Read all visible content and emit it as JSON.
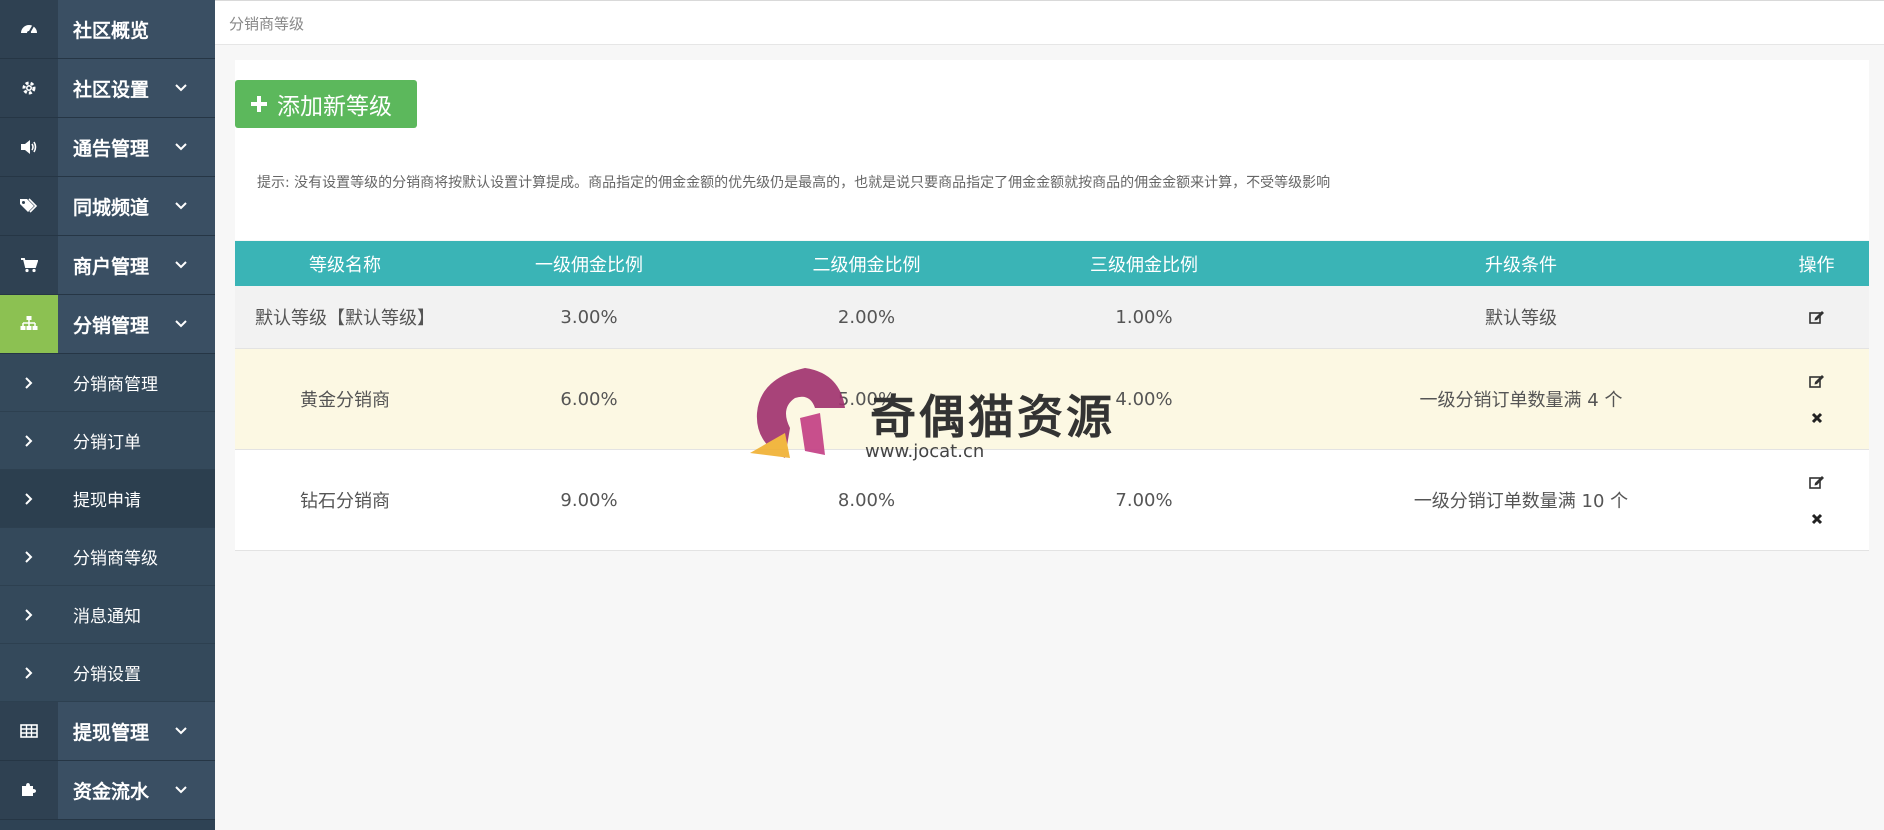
{
  "sidebar": {
    "items": [
      {
        "label": "社区概览",
        "icon": "dashboard-icon"
      },
      {
        "label": "社区设置",
        "icon": "gear-icon"
      },
      {
        "label": "通告管理",
        "icon": "volume-icon"
      },
      {
        "label": "同城频道",
        "icon": "tags-icon"
      },
      {
        "label": "商户管理",
        "icon": "cart-icon"
      },
      {
        "label": "分销管理",
        "icon": "sitemap-icon",
        "active": true
      },
      {
        "label": "提现管理",
        "icon": "table-icon"
      },
      {
        "label": "资金流水",
        "icon": "puzzle-icon"
      }
    ],
    "submenu": [
      {
        "label": "分销商管理"
      },
      {
        "label": "分销订单"
      },
      {
        "label": "提现申请"
      },
      {
        "label": "分销商等级"
      },
      {
        "label": "消息通知"
      },
      {
        "label": "分销设置"
      }
    ]
  },
  "breadcrumb": "分销商等级",
  "toolbar": {
    "add_label": "添加新等级"
  },
  "tip": "提示: 没有设置等级的分销商将按默认设置计算提成。商品指定的佣金金额的优先级仍是最高的，也就是说只要商品指定了佣金金额就按商品的佣金金额来计算，不受等级影响",
  "table": {
    "headers": [
      "等级名称",
      "一级佣金比例",
      "二级佣金比例",
      "三级佣金比例",
      "升级条件",
      "操作"
    ],
    "rows": [
      [
        "默认等级【默认等级】",
        "3.00%",
        "2.00%",
        "1.00%",
        "默认等级"
      ],
      [
        "黄金分销商",
        "6.00%",
        "5.00%",
        "4.00%",
        "一级分销订单数量满 4 个"
      ],
      [
        "钻石分销商",
        "9.00%",
        "8.00%",
        "7.00%",
        "一级分销订单数量满 10 个"
      ]
    ]
  },
  "watermark": {
    "text": "奇偶猫资源",
    "url": "www.jocat.cn"
  },
  "colors": {
    "accent": "#3ab4b6",
    "add_button": "#5cb85c",
    "active_menu": "#8cc152",
    "sidebar": "#2e4254",
    "highlight_row": "#fcf8e3"
  }
}
